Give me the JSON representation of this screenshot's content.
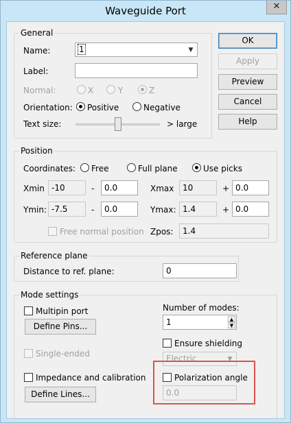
{
  "window": {
    "title": "Waveguide Port",
    "close_glyph": "✕"
  },
  "general": {
    "legend": "General",
    "name_label": "Name:",
    "name_value": "1",
    "label_label": "Label:",
    "label_value": "",
    "normal_label": "Normal:",
    "normal_options": [
      "X",
      "Y",
      "Z"
    ],
    "normal_selected": "Z",
    "orientation_label": "Orientation:",
    "orientation_options": [
      "Positive",
      "Negative"
    ],
    "orientation_selected": "Positive",
    "textsize_label": "Text size:",
    "textsize_right": "> large"
  },
  "buttons": {
    "ok": "OK",
    "apply": "Apply",
    "preview": "Preview",
    "cancel": "Cancel",
    "help": "Help"
  },
  "position": {
    "legend": "Position",
    "coordinates_label": "Coordinates:",
    "coord_options": [
      "Free",
      "Full plane",
      "Use picks"
    ],
    "coord_selected": "Use picks",
    "xmin_label": "Xmin",
    "xmin_value": "-10",
    "xmin_offset": "0.0",
    "xmax_label": "Xmax",
    "xmax_value": "10",
    "xmax_offset": "0.0",
    "ymin_label": "Ymin:",
    "ymin_value": "-7.5",
    "ymin_offset": "0.0",
    "ymax_label": "Ymax:",
    "ymax_value": "1.4",
    "ymax_offset": "0.0",
    "minus": "-",
    "plus": "+",
    "free_normal_label": "Free normal position",
    "zpos_label": "Zpos:",
    "zpos_value": "1.4"
  },
  "reference": {
    "legend": "Reference plane",
    "distance_label": "Distance to ref. plane:",
    "distance_value": "0"
  },
  "modes": {
    "legend": "Mode settings",
    "multipin_label": "Multipin port",
    "define_pins": "Define Pins...",
    "single_ended": "Single-ended",
    "impedance_label": "Impedance and calibration",
    "define_lines": "Define Lines...",
    "num_modes_label": "Number of modes:",
    "num_modes_value": "1",
    "ensure_shielding": "Ensure shielding",
    "shielding_type": "Electric",
    "polarization_label": "Polarization angle",
    "polarization_value": "0.0"
  },
  "colors": {
    "titlebar": "#c8e6f6",
    "client": "#f0f0f0",
    "highlight_box": "#d9534f"
  }
}
